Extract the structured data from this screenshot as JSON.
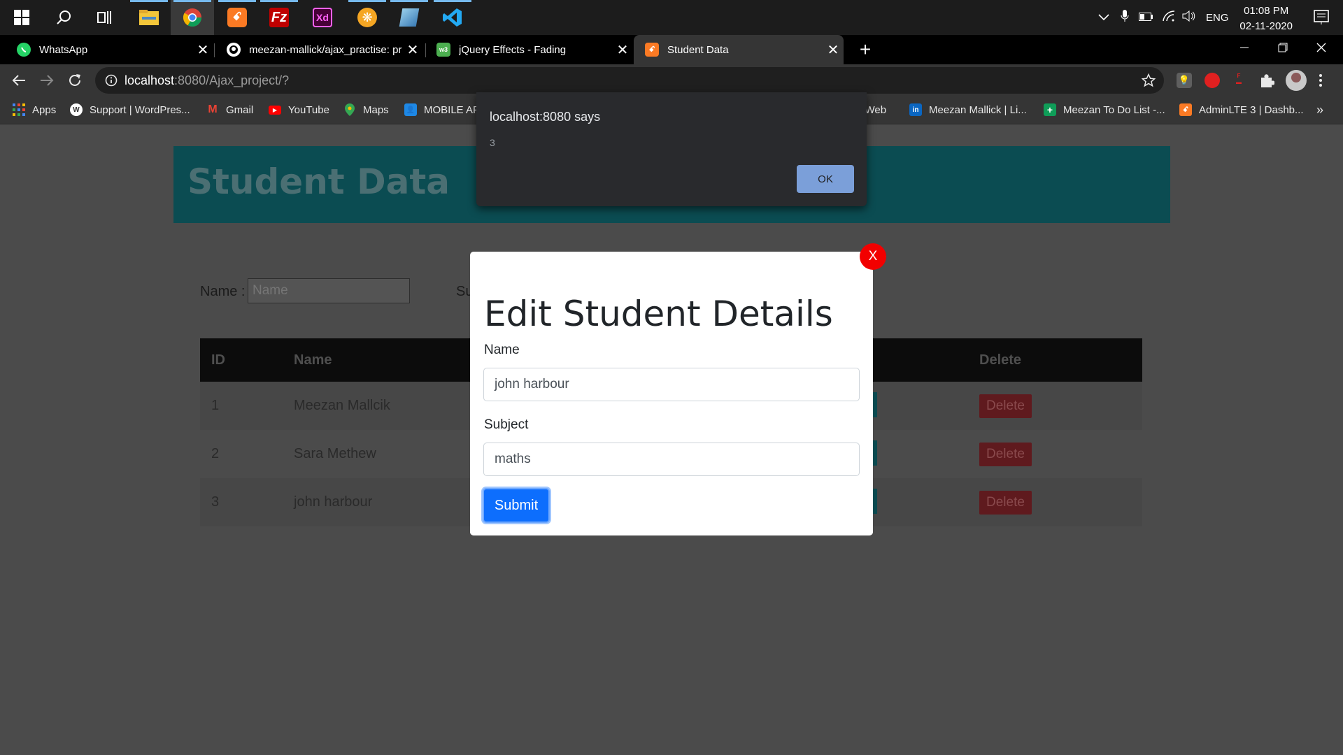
{
  "taskbar": {
    "apps": [
      {
        "name": "start"
      },
      {
        "name": "search"
      },
      {
        "name": "task-view"
      },
      {
        "name": "file-explorer"
      },
      {
        "name": "chrome"
      },
      {
        "name": "xampp"
      },
      {
        "name": "filezilla"
      },
      {
        "name": "adobe-xd"
      },
      {
        "name": "app-orange"
      },
      {
        "name": "app-notes"
      },
      {
        "name": "vscode"
      }
    ],
    "language": "ENG",
    "time": "01:08 PM",
    "date": "02-11-2020"
  },
  "tabs": [
    {
      "title": "WhatsApp",
      "close": "✕"
    },
    {
      "title": "meezan-mallick/ajax_practise: pr",
      "close": "✕"
    },
    {
      "title": "jQuery Effects - Fading",
      "close": "✕"
    },
    {
      "title": "Student Data",
      "close": "✕"
    }
  ],
  "new_tab": "+",
  "address": {
    "host": "localhost",
    "rest": ":8080/Ajax_project/?"
  },
  "bookmarks": [
    {
      "label": "Apps"
    },
    {
      "label": "Support | WordPres..."
    },
    {
      "label": "Gmail"
    },
    {
      "label": "YouTube"
    },
    {
      "label": "Maps"
    },
    {
      "label": "MOBILE AF"
    },
    {
      "label": "n Web"
    },
    {
      "label": "Meezan Mallick | Li..."
    },
    {
      "label": "Meezan To Do List -..."
    },
    {
      "label": "AdminLTE 3 | Dashb..."
    }
  ],
  "bookmarks_more": "»",
  "page": {
    "title": "Student Data",
    "form": {
      "name_label": "Name :",
      "name_placeholder": "Name",
      "subject_label_partial": "Su"
    },
    "table": {
      "headers": {
        "id": "ID",
        "name": "Name",
        "delete": "Delete"
      },
      "rows": [
        {
          "id": "1",
          "name": "Meezan Mallcik",
          "delete": "Delete"
        },
        {
          "id": "2",
          "name": "Sara Methew",
          "delete": "Delete"
        },
        {
          "id": "3",
          "name": "john harbour",
          "delete": "Delete"
        }
      ]
    }
  },
  "modal": {
    "title": "Edit Student Details",
    "close": "X",
    "name_label": "Name",
    "name_value": "john harbour",
    "subject_label": "Subject",
    "subject_value": "maths",
    "submit": "Submit"
  },
  "alert": {
    "title": "localhost:8080 says",
    "message": "3",
    "ok": "OK"
  }
}
